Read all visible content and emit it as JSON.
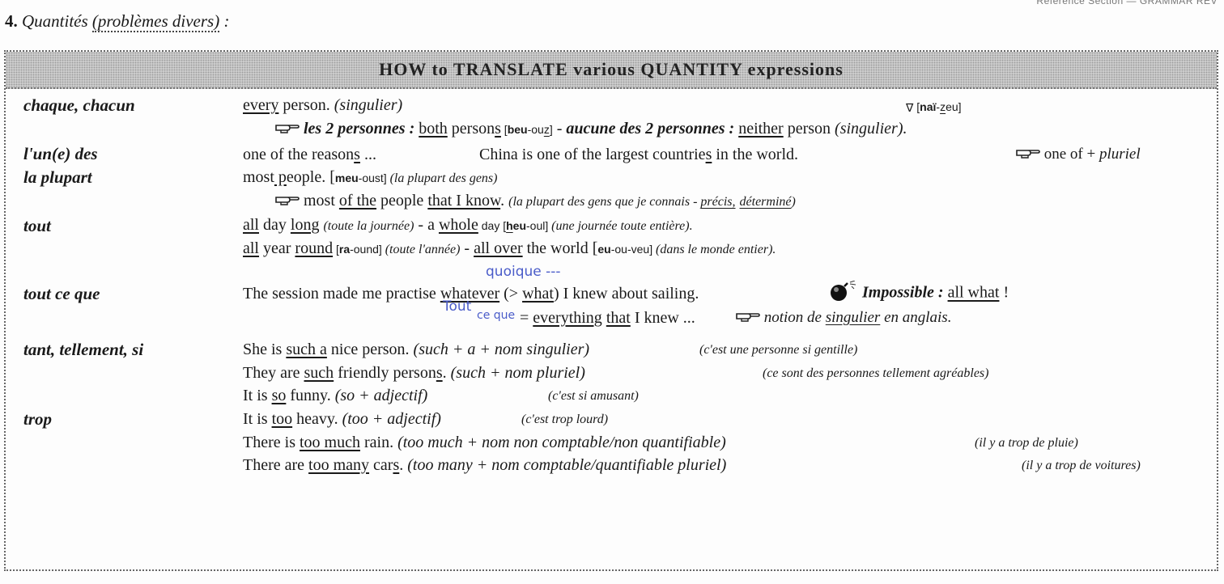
{
  "header": {
    "corner_ref": "Reference Section — GRAMMAR REV",
    "section_number": "4.",
    "section_title_a": "Quantités",
    "section_title_b": "(problèmes divers)",
    "section_title_c": ":"
  },
  "box_title": "HOW to TRANSLATE various QUANTITY expressions",
  "terms": {
    "chaque": "chaque, chacun",
    "lun": "l'un(e) des",
    "plupart": "la plupart",
    "tout": "tout",
    "toutceque": "tout ce que",
    "tant": "tant, tellement, si",
    "trop": "trop"
  },
  "l1": {
    "a": "every",
    "b": " person. ",
    "c": "(singulier)",
    "d": "[",
    "e": "naï",
    "f": "-",
    "g": "z",
    "h": "eu]"
  },
  "l2": {
    "a": "les 2 personnes :",
    "b": " ",
    "c": "both",
    "d": " person",
    "e": "s",
    "f": " [",
    "g": "beu",
    "h": "-ou",
    "i": "z",
    "j": "]",
    "k": " - ",
    "l": "aucune des 2 personnes :",
    "m": " ",
    "n": "neither",
    "o": " person ",
    "p": "(singulier)."
  },
  "l3": {
    "a": "one of the reason",
    "b": "s",
    "c": " ...",
    "d": "China is one of the largest countrie",
    "e": "s",
    "f": " in the world.",
    "g": "one of + ",
    "h": "pluriel"
  },
  "l4": {
    "a": "most",
    "b": " p",
    "c": "eople. [",
    "d": "meu",
    "e": "-oust] ",
    "f": "(la plupart des gens)"
  },
  "l5": {
    "a": "most ",
    "b": "of the",
    "c": " people ",
    "d": "that I know",
    "e": ". ",
    "f": "(la plupart des gens que je connais - ",
    "g": "précis,",
    "h": " ",
    "i": "déterminé",
    "j": ")"
  },
  "l6": {
    "a": "all",
    "b": " day ",
    "c": "long",
    "d": " ",
    "e": "(toute la journée)",
    "f": " - a ",
    "g": "whole",
    "h": " day [",
    "i": "h",
    "j": "eu",
    "k": "-oul] ",
    "l": "(une journée toute entière)."
  },
  "l7": {
    "a": "all",
    "b": " year ",
    "c": "round",
    "d": " [",
    "e": "ra",
    "f": "-ound] ",
    "g": "(toute l'année)",
    "h": " - ",
    "i": "all over",
    "j": " the world [",
    "k": "eu",
    "l": "-ou-veu] ",
    "m": "(dans le monde entier)."
  },
  "l8": {
    "a": "The session made me practise ",
    "b": "whatever",
    "c": " (> ",
    "d": "what",
    "e": ") I knew about sailing.",
    "f": "Impossible :",
    "g": " ",
    "h": "all what",
    "i": " !"
  },
  "l9": {
    "a": "= ",
    "b": "everything",
    "c": " ",
    "d": "that",
    "e": " I knew ...",
    "f": "notion de ",
    "g": "singulier",
    "h": " en anglais."
  },
  "l10": {
    "a": "She is ",
    "b": "such a",
    "c": " nice person. ",
    "d": "(such + a + nom singulier)",
    "e": "(c'est une personne si gentille)"
  },
  "l11": {
    "a": "They are ",
    "b": "such",
    "c": " friendly person",
    "d": "s",
    "e": ". ",
    "f": "(such + nom pluriel)",
    "g": "(ce sont des personnes tellement agréables)"
  },
  "l12": {
    "a": "It is ",
    "b": "so",
    "c": " funny. ",
    "d": "(so + adjectif)",
    "e": "(c'est si amusant)"
  },
  "l13": {
    "a": "It is ",
    "b": "too",
    "c": " heavy. ",
    "d": "(too + adjectif)",
    "e": "(c'est trop lourd)"
  },
  "l14": {
    "a": "There is ",
    "b": "too much",
    "c": " rain. ",
    "d": "(too much + nom non comptable/non quantifiable)",
    "e": "(il y a trop de pluie)"
  },
  "l15": {
    "a": "There are ",
    "b": "too many",
    "c": " car",
    "d": "s",
    "e": ". ",
    "f": "(too many + nom comptable/quantifiable pluriel)",
    "g": "(il y a trop de voitures)"
  },
  "handwriting": {
    "quoique": "quoique ---",
    "tout": "Tout",
    "ce_que": "ce que"
  },
  "icons": {
    "triangle": "nabla-symbol",
    "hand": "pointing-hand-icon",
    "bomb": "bomb-icon"
  }
}
